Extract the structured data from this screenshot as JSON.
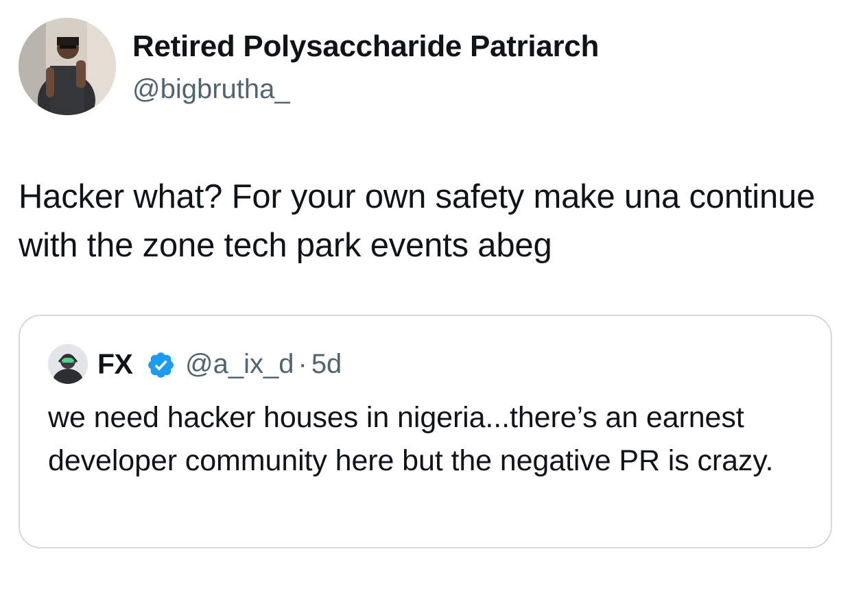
{
  "tweet": {
    "author": {
      "display_name": "Retired Polysaccharide Patriarch",
      "handle": "@bigbrutha_",
      "avatar": "profile-photo"
    },
    "text": "Hacker what? For your own safety make una continue with the zone tech park events abeg"
  },
  "quoted_tweet": {
    "author": {
      "display_name": "FX",
      "verified": true,
      "verified_color": "#1d9bf0",
      "handle": "@a_ix_d",
      "avatar": "profile-photo"
    },
    "separator": "·",
    "time": "5d",
    "text": "we need hacker houses in nigeria...there’s an earnest developer community here but the negative PR is crazy."
  },
  "colors": {
    "text_primary": "#0f1419",
    "text_secondary": "#536471",
    "border": "#cfd9de",
    "verified_blue": "#1d9bf0"
  }
}
